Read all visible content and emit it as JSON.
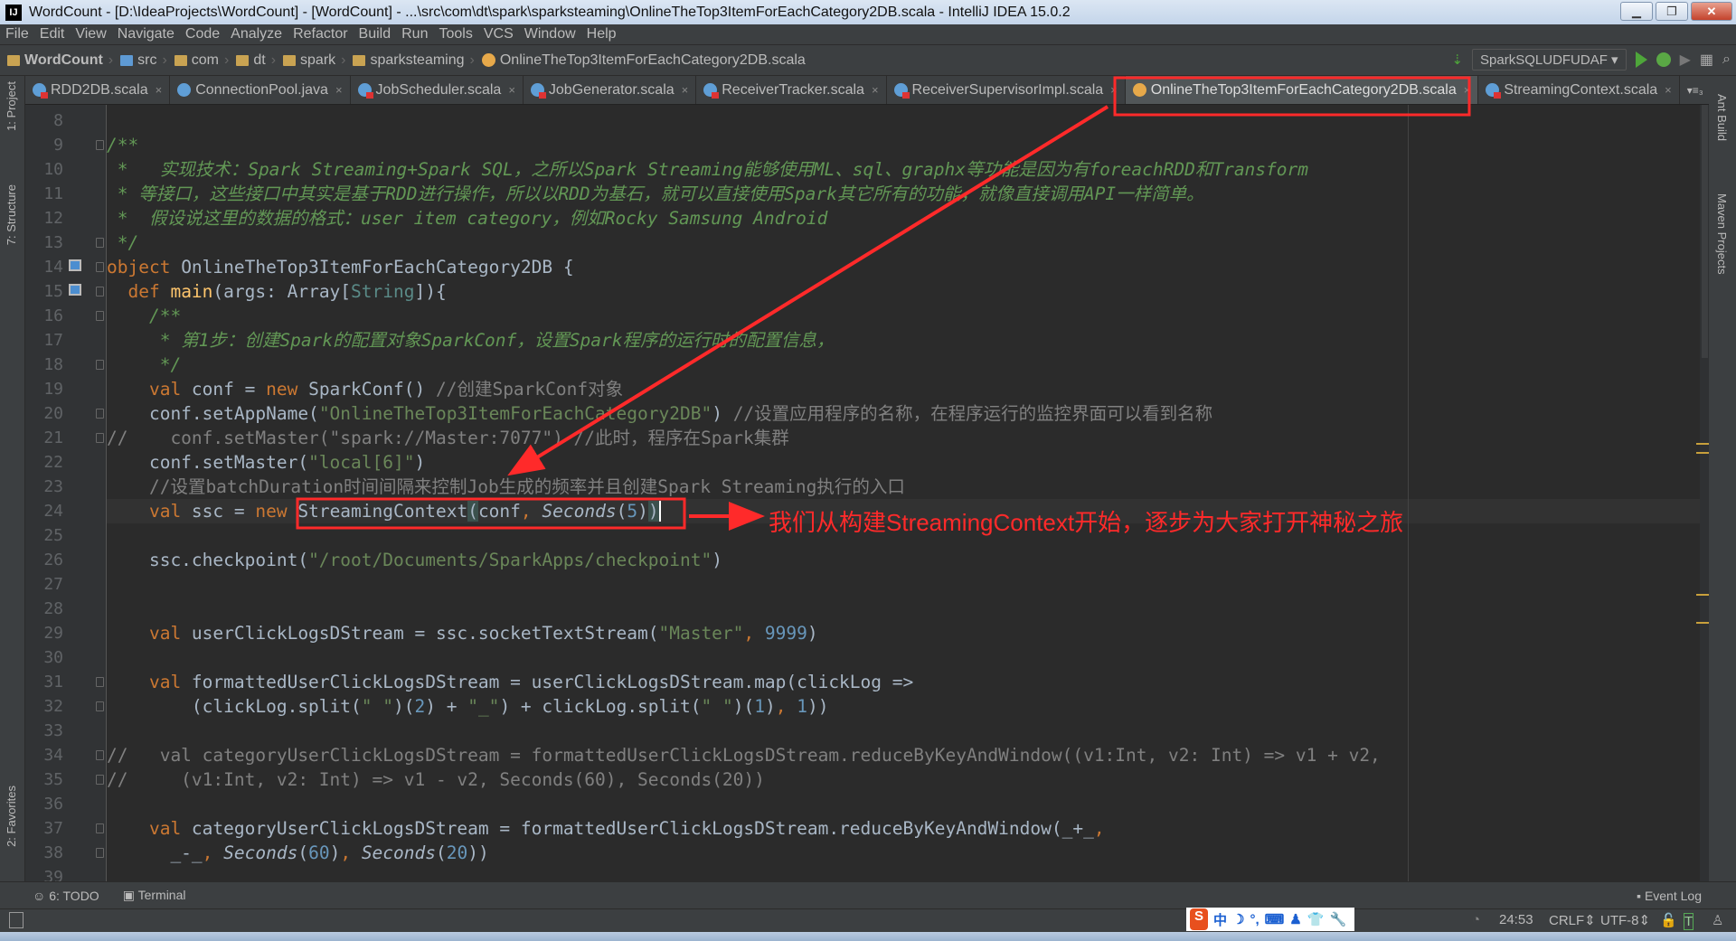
{
  "window": {
    "title": "WordCount - [D:\\IdeaProjects\\WordCount] - [WordCount] - ...\\src\\com\\dt\\spark\\sparksteaming\\OnlineTheTop3ItemForEachCategory2DB.scala - IntelliJ IDEA 15.0.2",
    "app_icon": "IJ"
  },
  "menu": [
    "File",
    "Edit",
    "View",
    "Navigate",
    "Code",
    "Analyze",
    "Refactor",
    "Build",
    "Run",
    "Tools",
    "VCS",
    "Window",
    "Help"
  ],
  "breadcrumb": [
    {
      "label": "WordCount",
      "icon": "project-folder-icon"
    },
    {
      "label": "src",
      "icon": "source-folder-icon"
    },
    {
      "label": "com",
      "icon": "package-icon"
    },
    {
      "label": "dt",
      "icon": "package-icon"
    },
    {
      "label": "spark",
      "icon": "package-icon"
    },
    {
      "label": "sparksteaming",
      "icon": "package-icon"
    },
    {
      "label": "OnlineTheTop3ItemForEachCategory2DB.scala",
      "icon": "scala-object-icon"
    }
  ],
  "run_config": "SparkSQLUDFUDAF",
  "tabs": [
    {
      "label": "RDD2DB.scala",
      "icon": "scala-class",
      "active": false
    },
    {
      "label": "ConnectionPool.java",
      "icon": "java-class",
      "active": false
    },
    {
      "label": "JobScheduler.scala",
      "icon": "scala-class",
      "active": false
    },
    {
      "label": "JobGenerator.scala",
      "icon": "scala-class",
      "active": false
    },
    {
      "label": "ReceiverTracker.scala",
      "icon": "scala-class",
      "active": false
    },
    {
      "label": "ReceiverSupervisorImpl.scala",
      "icon": "scala-class",
      "active": false
    },
    {
      "label": "OnlineTheTop3ItemForEachCategory2DB.scala",
      "icon": "scala-object",
      "active": true
    },
    {
      "label": "StreamingContext.scala",
      "icon": "scala-class",
      "active": false
    }
  ],
  "tab_overflow": "▾≡₃",
  "left_tools": [
    "1: Project",
    "7: Structure",
    "2: Favorites"
  ],
  "right_tools": [
    "Ant Build",
    "Maven Projects"
  ],
  "editor": {
    "current_line": 24,
    "lines": [
      {
        "n": 8,
        "tokens": []
      },
      {
        "n": 9,
        "tokens": [
          [
            "doc",
            "/**"
          ]
        ]
      },
      {
        "n": 10,
        "tokens": [
          [
            "doc",
            " *   实现技术：Spark Streaming+Spark SQL，之所以Spark Streaming能够使用ML、sql、graphx等功能是因为有foreachRDD和Transform"
          ]
        ]
      },
      {
        "n": 11,
        "tokens": [
          [
            "doc",
            " * 等接口，这些接口中其实是基于RDD进行操作，所以以RDD为基石，就可以直接使用Spark其它所有的功能，就像直接调用API一样简单。"
          ]
        ]
      },
      {
        "n": 12,
        "tokens": [
          [
            "doc",
            " *  假设说这里的数据的格式：user item category，例如Rocky Samsung Android"
          ]
        ]
      },
      {
        "n": 13,
        "tokens": [
          [
            "doc",
            " */"
          ]
        ]
      },
      {
        "n": 14,
        "tokens": [
          [
            "kw",
            "object "
          ],
          [
            "",
            "OnlineTheTop3ItemForEachCategory2DB {"
          ]
        ]
      },
      {
        "n": 15,
        "tokens": [
          [
            "kw",
            "  def "
          ],
          [
            "fn",
            "main"
          ],
          [
            "",
            "(args: Array["
          ],
          [
            "ty",
            "String"
          ],
          [
            "",
            "]){"
          ]
        ]
      },
      {
        "n": 16,
        "tokens": [
          [
            "doc",
            "    /**"
          ]
        ]
      },
      {
        "n": 17,
        "tokens": [
          [
            "doc",
            "     * 第1步：创建Spark的配置对象SparkConf，设置Spark程序的运行时的配置信息，"
          ]
        ]
      },
      {
        "n": 18,
        "tokens": [
          [
            "doc",
            "     */"
          ]
        ]
      },
      {
        "n": 19,
        "tokens": [
          [
            "kw",
            "    val "
          ],
          [
            "",
            "conf = "
          ],
          [
            "kw",
            "new "
          ],
          [
            "",
            "SparkConf() "
          ],
          [
            "cm",
            "//创建SparkConf对象"
          ]
        ]
      },
      {
        "n": 20,
        "tokens": [
          [
            "",
            "    conf.setAppName("
          ],
          [
            "str",
            "\"OnlineTheTop3ItemForEachCategory2DB\""
          ],
          [
            "",
            ") "
          ],
          [
            "cm",
            "//设置应用程序的名称，在程序运行的监控界面可以看到名称"
          ]
        ]
      },
      {
        "n": 21,
        "tokens": [
          [
            "cm",
            "//    conf.setMaster(\"spark://Master:7077\") //此时，程序在Spark集群"
          ]
        ]
      },
      {
        "n": 22,
        "tokens": [
          [
            "",
            "    conf.setMaster("
          ],
          [
            "str",
            "\"local[6]\""
          ],
          [
            "",
            ")"
          ]
        ]
      },
      {
        "n": 23,
        "tokens": [
          [
            "cm",
            "    //设置batchDuration时间间隔来控制Job生成的频率并且创建Spark Streaming执行的入口"
          ]
        ]
      },
      {
        "n": 24,
        "tokens": [
          [
            "kw",
            "    val "
          ],
          [
            "",
            "ssc = "
          ],
          [
            "kw",
            "new "
          ],
          [
            "",
            "StreamingContext"
          ],
          [
            "paren",
            "("
          ],
          [
            "",
            "conf"
          ],
          [
            "kw",
            ", "
          ],
          [
            "it",
            "Seconds"
          ],
          [
            "",
            "("
          ],
          [
            "num",
            "5"
          ],
          [
            "",
            ")"
          ],
          [
            "paren",
            ")"
          ]
        ]
      },
      {
        "n": 25,
        "tokens": []
      },
      {
        "n": 26,
        "tokens": [
          [
            "",
            "    ssc.checkpoint("
          ],
          [
            "str",
            "\"/root/Documents/SparkApps/checkpoint\""
          ],
          [
            "",
            ")"
          ]
        ]
      },
      {
        "n": 27,
        "tokens": []
      },
      {
        "n": 28,
        "tokens": []
      },
      {
        "n": 29,
        "tokens": [
          [
            "kw",
            "    val "
          ],
          [
            "",
            "userClickLogsDStream = ssc.socketTextStream("
          ],
          [
            "str",
            "\"Master\""
          ],
          [
            "kw",
            ", "
          ],
          [
            "num",
            "9999"
          ],
          [
            "",
            ")"
          ]
        ]
      },
      {
        "n": 30,
        "tokens": []
      },
      {
        "n": 31,
        "tokens": [
          [
            "kw",
            "    val "
          ],
          [
            "",
            "formattedUserClickLogsDStream = userClickLogsDStream.map(clickLog =>"
          ]
        ]
      },
      {
        "n": 32,
        "tokens": [
          [
            "",
            "        (clickLog.split("
          ],
          [
            "str",
            "\" \""
          ],
          [
            "",
            ")("
          ],
          [
            "num",
            "2"
          ],
          [
            "",
            ") + "
          ],
          [
            "str",
            "\"_\""
          ],
          [
            "",
            ") + clickLog.split("
          ],
          [
            "str",
            "\" \""
          ],
          [
            "",
            ")("
          ],
          [
            "num",
            "1"
          ],
          [
            "",
            ")"
          ],
          [
            "kw",
            ", "
          ],
          [
            "num",
            "1"
          ],
          [
            "",
            "))"
          ]
        ]
      },
      {
        "n": 33,
        "tokens": []
      },
      {
        "n": 34,
        "tokens": [
          [
            "cm",
            "//   val categoryUserClickLogsDStream = formattedUserClickLogsDStream.reduceByKeyAndWindow((v1:Int, v2: Int) => v1 + v2,"
          ]
        ]
      },
      {
        "n": 35,
        "tokens": [
          [
            "cm",
            "//     (v1:Int, v2: Int) => v1 - v2, Seconds(60), Seconds(20))"
          ]
        ]
      },
      {
        "n": 36,
        "tokens": []
      },
      {
        "n": 37,
        "tokens": [
          [
            "kw",
            "    val "
          ],
          [
            "",
            "categoryUserClickLogsDStream = formattedUserClickLogsDStream.reduceByKeyAndWindow(_+_"
          ],
          [
            "kw",
            ","
          ]
        ]
      },
      {
        "n": 38,
        "tokens": [
          [
            "",
            "      _-_"
          ],
          [
            "kw",
            ", "
          ],
          [
            "it",
            "Seconds"
          ],
          [
            "",
            "("
          ],
          [
            "num",
            "60"
          ],
          [
            "",
            ")"
          ],
          [
            "kw",
            ", "
          ],
          [
            "it",
            "Seconds"
          ],
          [
            "",
            "("
          ],
          [
            "num",
            "20"
          ],
          [
            "",
            "))"
          ]
        ]
      },
      {
        "n": 39,
        "tokens": []
      }
    ]
  },
  "annotation": {
    "text": "我们从构建StreamingContext开始，逐步为大家打开神秘之旅",
    "color": "#ff2a2a"
  },
  "bottom_tools": {
    "todo": "6: TODO",
    "terminal": "Terminal",
    "event_log": "Event Log"
  },
  "status": {
    "position": "24:53",
    "line_sep": "CRLF",
    "encoding": "UTF-8"
  },
  "ime": {
    "logo": "S",
    "items": [
      "中",
      "☽",
      "°,",
      "⌨",
      "♟",
      "👕",
      "🔧"
    ]
  },
  "colors": {
    "background": "#2b2b2b",
    "keyword": "#cc7832",
    "string": "#6a8759",
    "comment": "#808080",
    "doc_comment": "#629755",
    "number": "#6897bb",
    "annotation_red": "#ff2a2a"
  }
}
